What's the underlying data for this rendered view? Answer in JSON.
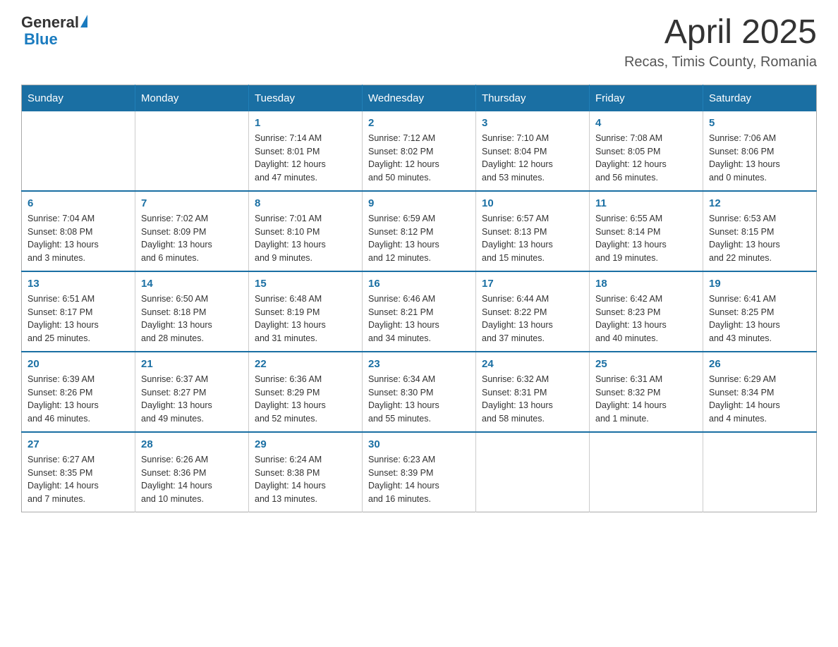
{
  "logo": {
    "text_general": "General",
    "text_blue": "Blue"
  },
  "header": {
    "month_year": "April 2025",
    "location": "Recas, Timis County, Romania"
  },
  "weekdays": [
    "Sunday",
    "Monday",
    "Tuesday",
    "Wednesday",
    "Thursday",
    "Friday",
    "Saturday"
  ],
  "weeks": [
    [
      {
        "day": "",
        "info": ""
      },
      {
        "day": "",
        "info": ""
      },
      {
        "day": "1",
        "info": "Sunrise: 7:14 AM\nSunset: 8:01 PM\nDaylight: 12 hours\nand 47 minutes."
      },
      {
        "day": "2",
        "info": "Sunrise: 7:12 AM\nSunset: 8:02 PM\nDaylight: 12 hours\nand 50 minutes."
      },
      {
        "day": "3",
        "info": "Sunrise: 7:10 AM\nSunset: 8:04 PM\nDaylight: 12 hours\nand 53 minutes."
      },
      {
        "day": "4",
        "info": "Sunrise: 7:08 AM\nSunset: 8:05 PM\nDaylight: 12 hours\nand 56 minutes."
      },
      {
        "day": "5",
        "info": "Sunrise: 7:06 AM\nSunset: 8:06 PM\nDaylight: 13 hours\nand 0 minutes."
      }
    ],
    [
      {
        "day": "6",
        "info": "Sunrise: 7:04 AM\nSunset: 8:08 PM\nDaylight: 13 hours\nand 3 minutes."
      },
      {
        "day": "7",
        "info": "Sunrise: 7:02 AM\nSunset: 8:09 PM\nDaylight: 13 hours\nand 6 minutes."
      },
      {
        "day": "8",
        "info": "Sunrise: 7:01 AM\nSunset: 8:10 PM\nDaylight: 13 hours\nand 9 minutes."
      },
      {
        "day": "9",
        "info": "Sunrise: 6:59 AM\nSunset: 8:12 PM\nDaylight: 13 hours\nand 12 minutes."
      },
      {
        "day": "10",
        "info": "Sunrise: 6:57 AM\nSunset: 8:13 PM\nDaylight: 13 hours\nand 15 minutes."
      },
      {
        "day": "11",
        "info": "Sunrise: 6:55 AM\nSunset: 8:14 PM\nDaylight: 13 hours\nand 19 minutes."
      },
      {
        "day": "12",
        "info": "Sunrise: 6:53 AM\nSunset: 8:15 PM\nDaylight: 13 hours\nand 22 minutes."
      }
    ],
    [
      {
        "day": "13",
        "info": "Sunrise: 6:51 AM\nSunset: 8:17 PM\nDaylight: 13 hours\nand 25 minutes."
      },
      {
        "day": "14",
        "info": "Sunrise: 6:50 AM\nSunset: 8:18 PM\nDaylight: 13 hours\nand 28 minutes."
      },
      {
        "day": "15",
        "info": "Sunrise: 6:48 AM\nSunset: 8:19 PM\nDaylight: 13 hours\nand 31 minutes."
      },
      {
        "day": "16",
        "info": "Sunrise: 6:46 AM\nSunset: 8:21 PM\nDaylight: 13 hours\nand 34 minutes."
      },
      {
        "day": "17",
        "info": "Sunrise: 6:44 AM\nSunset: 8:22 PM\nDaylight: 13 hours\nand 37 minutes."
      },
      {
        "day": "18",
        "info": "Sunrise: 6:42 AM\nSunset: 8:23 PM\nDaylight: 13 hours\nand 40 minutes."
      },
      {
        "day": "19",
        "info": "Sunrise: 6:41 AM\nSunset: 8:25 PM\nDaylight: 13 hours\nand 43 minutes."
      }
    ],
    [
      {
        "day": "20",
        "info": "Sunrise: 6:39 AM\nSunset: 8:26 PM\nDaylight: 13 hours\nand 46 minutes."
      },
      {
        "day": "21",
        "info": "Sunrise: 6:37 AM\nSunset: 8:27 PM\nDaylight: 13 hours\nand 49 minutes."
      },
      {
        "day": "22",
        "info": "Sunrise: 6:36 AM\nSunset: 8:29 PM\nDaylight: 13 hours\nand 52 minutes."
      },
      {
        "day": "23",
        "info": "Sunrise: 6:34 AM\nSunset: 8:30 PM\nDaylight: 13 hours\nand 55 minutes."
      },
      {
        "day": "24",
        "info": "Sunrise: 6:32 AM\nSunset: 8:31 PM\nDaylight: 13 hours\nand 58 minutes."
      },
      {
        "day": "25",
        "info": "Sunrise: 6:31 AM\nSunset: 8:32 PM\nDaylight: 14 hours\nand 1 minute."
      },
      {
        "day": "26",
        "info": "Sunrise: 6:29 AM\nSunset: 8:34 PM\nDaylight: 14 hours\nand 4 minutes."
      }
    ],
    [
      {
        "day": "27",
        "info": "Sunrise: 6:27 AM\nSunset: 8:35 PM\nDaylight: 14 hours\nand 7 minutes."
      },
      {
        "day": "28",
        "info": "Sunrise: 6:26 AM\nSunset: 8:36 PM\nDaylight: 14 hours\nand 10 minutes."
      },
      {
        "day": "29",
        "info": "Sunrise: 6:24 AM\nSunset: 8:38 PM\nDaylight: 14 hours\nand 13 minutes."
      },
      {
        "day": "30",
        "info": "Sunrise: 6:23 AM\nSunset: 8:39 PM\nDaylight: 14 hours\nand 16 minutes."
      },
      {
        "day": "",
        "info": ""
      },
      {
        "day": "",
        "info": ""
      },
      {
        "day": "",
        "info": ""
      }
    ]
  ]
}
